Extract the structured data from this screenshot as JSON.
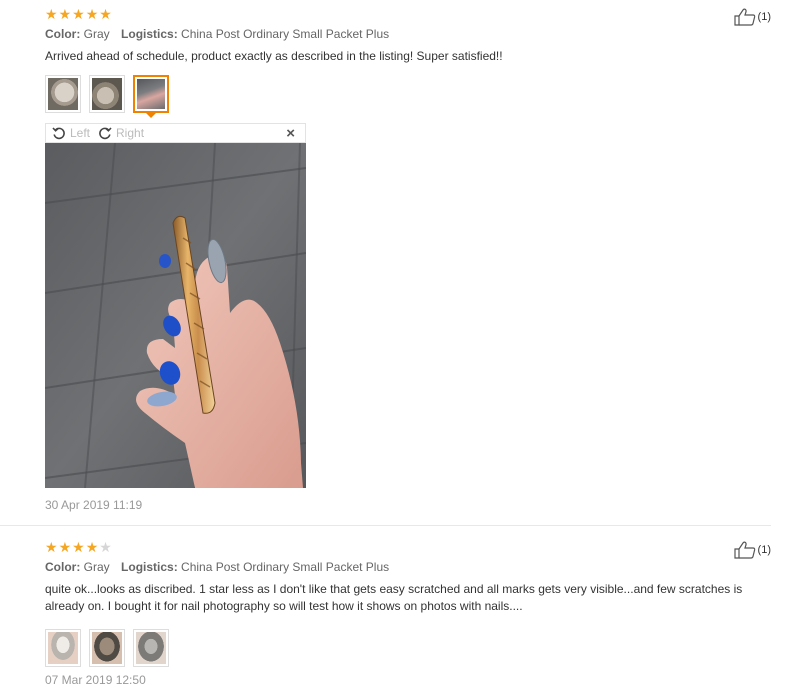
{
  "reviews": [
    {
      "rating": 5,
      "helpful_count": "(1)",
      "color_label": "Color:",
      "color_value": "Gray",
      "logistics_label": "Logistics:",
      "logistics_value": "China Post Ordinary Small Packet Plus",
      "text": "Arrived ahead of schedule, product exactly as described in the listing! Super satisfied!!",
      "date": "30 Apr 2019 11:19",
      "viewer": {
        "left_label": "Left",
        "right_label": "Right",
        "close_symbol": "×"
      }
    },
    {
      "rating": 4,
      "helpful_count": "(1)",
      "color_label": "Color:",
      "color_value": "Gray",
      "logistics_label": "Logistics:",
      "logistics_value": "China Post Ordinary Small Packet Plus",
      "text": "quite ok...looks as discribed. 1 star less as I don't like that gets easy scratched and all marks gets very visible...and few scratches is already on. I bought it for nail photography so will test how it shows on photos with nails....",
      "date": "07 Mar 2019 12:50"
    }
  ],
  "colors": {
    "star_filled": "#f5a623",
    "star_empty": "#d6d6d6",
    "active_thumb_border": "#f08200"
  },
  "icons": [
    "thumbs-up-icon",
    "rotate-left-icon",
    "rotate-right-icon",
    "close-icon",
    "star-icon"
  ]
}
